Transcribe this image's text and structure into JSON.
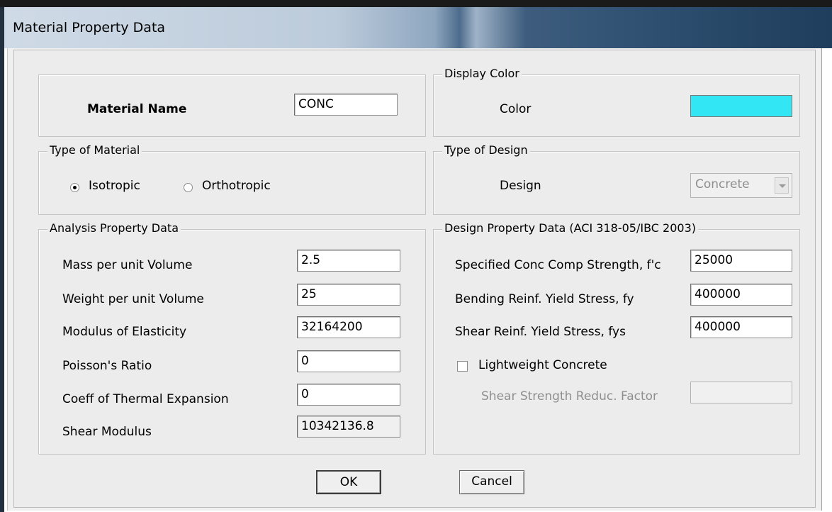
{
  "window": {
    "title": "Material Property Data"
  },
  "material": {
    "name_label": "Material Name",
    "name_value": "CONC"
  },
  "display_color": {
    "legend": "Display Color",
    "color_label": "Color",
    "color_value": "#33e6f3"
  },
  "type_of_material": {
    "legend": "Type of Material",
    "options": [
      {
        "label": "Isotropic",
        "selected": true
      },
      {
        "label": "Orthotropic",
        "selected": false
      }
    ]
  },
  "type_of_design": {
    "legend": "Type of Design",
    "design_label": "Design",
    "design_value": "Concrete"
  },
  "analysis": {
    "legend": "Analysis Property Data",
    "rows": [
      {
        "label": "Mass per unit Volume",
        "value": "2.5"
      },
      {
        "label": "Weight per unit Volume",
        "value": "25"
      },
      {
        "label": "Modulus of Elasticity",
        "value": "32164200"
      },
      {
        "label": "Poisson's Ratio",
        "value": "0"
      },
      {
        "label": "Coeff of Thermal Expansion",
        "value": "0"
      },
      {
        "label": "Shear Modulus",
        "value": "10342136.8"
      }
    ]
  },
  "design_props": {
    "legend": "Design Property Data (ACI 318-05/IBC 2003)",
    "rows": [
      {
        "label": "Specified Conc Comp Strength, f'c",
        "value": "25000"
      },
      {
        "label": "Bending Reinf. Yield Stress, fy",
        "value": "400000"
      },
      {
        "label": "Shear Reinf. Yield Stress, fys",
        "value": "400000"
      }
    ],
    "lightweight_label": "Lightweight Concrete",
    "lightweight_checked": false,
    "shear_reduc_label": "Shear Strength Reduc. Factor",
    "shear_reduc_value": ""
  },
  "buttons": {
    "ok": "OK",
    "cancel": "Cancel"
  }
}
